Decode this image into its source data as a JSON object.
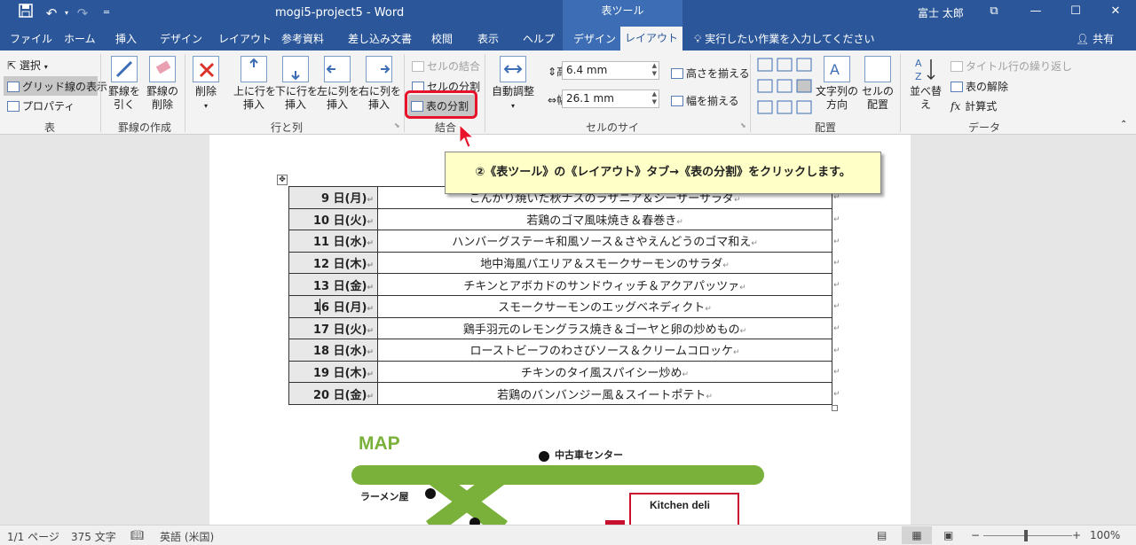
{
  "title_bar": {
    "doc_title": "mogi5-project5  -  Word",
    "tool_group": "表ツール",
    "user": "富士 太郎",
    "qat_save_icon": "save-icon",
    "qat_undo_icon": "undo-icon",
    "qat_redo_icon": "redo-icon"
  },
  "tabs": [
    "ファイル",
    "ホーム",
    "挿入",
    "デザイン",
    "レイアウト",
    "参考資料",
    "差し込み文書",
    "校閲",
    "表示",
    "ヘルプ",
    "デザイン",
    "レイアウト"
  ],
  "tell_me": "実行したい作業を入力してください",
  "share": "共有",
  "ribbon": {
    "table_group": {
      "select": "選択",
      "gridlines": "グリッド線の表示",
      "properties": "プロパティ",
      "label": "表"
    },
    "draw_group": {
      "draw_line": "罫線を\n引く",
      "erase": "罫線の\n削除",
      "label": "罫線の作成"
    },
    "rows_cols": {
      "delete": "削除",
      "insert_above": "上に行を\n挿入",
      "insert_below": "下に行を\n挿入",
      "insert_left": "左に列を\n挿入",
      "insert_right": "右に列を\n挿入",
      "label": "行と列"
    },
    "merge": {
      "merge_cells": "セルの結合",
      "split_cells": "セルの分割",
      "split_table": "表の分割",
      "label": "結合"
    },
    "cell_size": {
      "autofit": "自動調整",
      "height_label": "高さ:",
      "height_value": "6.4 mm",
      "width_label": "幅:",
      "width_value": "26.1 mm",
      "distribute_rows": "高さを揃える",
      "distribute_cols": "幅を揃える",
      "label": "セルのサイズ"
    },
    "alignment": {
      "text_direction": "文字列の\n方向",
      "cell_margins": "セルの\n配置",
      "label": "配置"
    },
    "data": {
      "sort": "並べ替え",
      "repeat_header": "タイトル行の繰り返し",
      "convert": "表の解除",
      "formula": "計算式",
      "label": "データ"
    }
  },
  "callout": "②《表ツール》の《レイアウト》タブ→《表の分割》をクリックします。",
  "menu_rows": [
    {
      "day": "9 日(月)",
      "dish": "こんがり焼いた秋ナスのラザニア＆シーザーサラダ"
    },
    {
      "day": "10 日(火)",
      "dish": "若鶏のゴマ風味焼き＆春巻き"
    },
    {
      "day": "11 日(水)",
      "dish": "ハンバーグステーキ和風ソース＆さやえんどうのゴマ和え"
    },
    {
      "day": "12 日(木)",
      "dish": "地中海風パエリア＆スモークサーモンのサラダ"
    },
    {
      "day": "13 日(金)",
      "dish": "チキンとアボカドのサンドウィッチ＆アクアパッツァ"
    },
    {
      "day": "16 日(月)",
      "dish": "スモークサーモンのエッグベネディクト"
    },
    {
      "day": "17 日(火)",
      "dish": "鶏手羽元のレモングラス焼き＆ゴーヤと卵の炒めもの"
    },
    {
      "day": "18 日(水)",
      "dish": "ローストビーフのわさびソース＆クリームコロッケ"
    },
    {
      "day": "19 日(木)",
      "dish": "チキンのタイ風スパイシー炒め"
    },
    {
      "day": "20 日(金)",
      "dish": "若鶏のバンバンジー風＆スイートポテト"
    }
  ],
  "map": {
    "title": "MAP",
    "label1": "中古車センター",
    "label2": "ラーメン屋",
    "shop": "Kitchen deli"
  },
  "status": {
    "page": "1/1 ページ",
    "words": "375 文字",
    "lang": "英語 (米国)",
    "zoom": "100%"
  }
}
